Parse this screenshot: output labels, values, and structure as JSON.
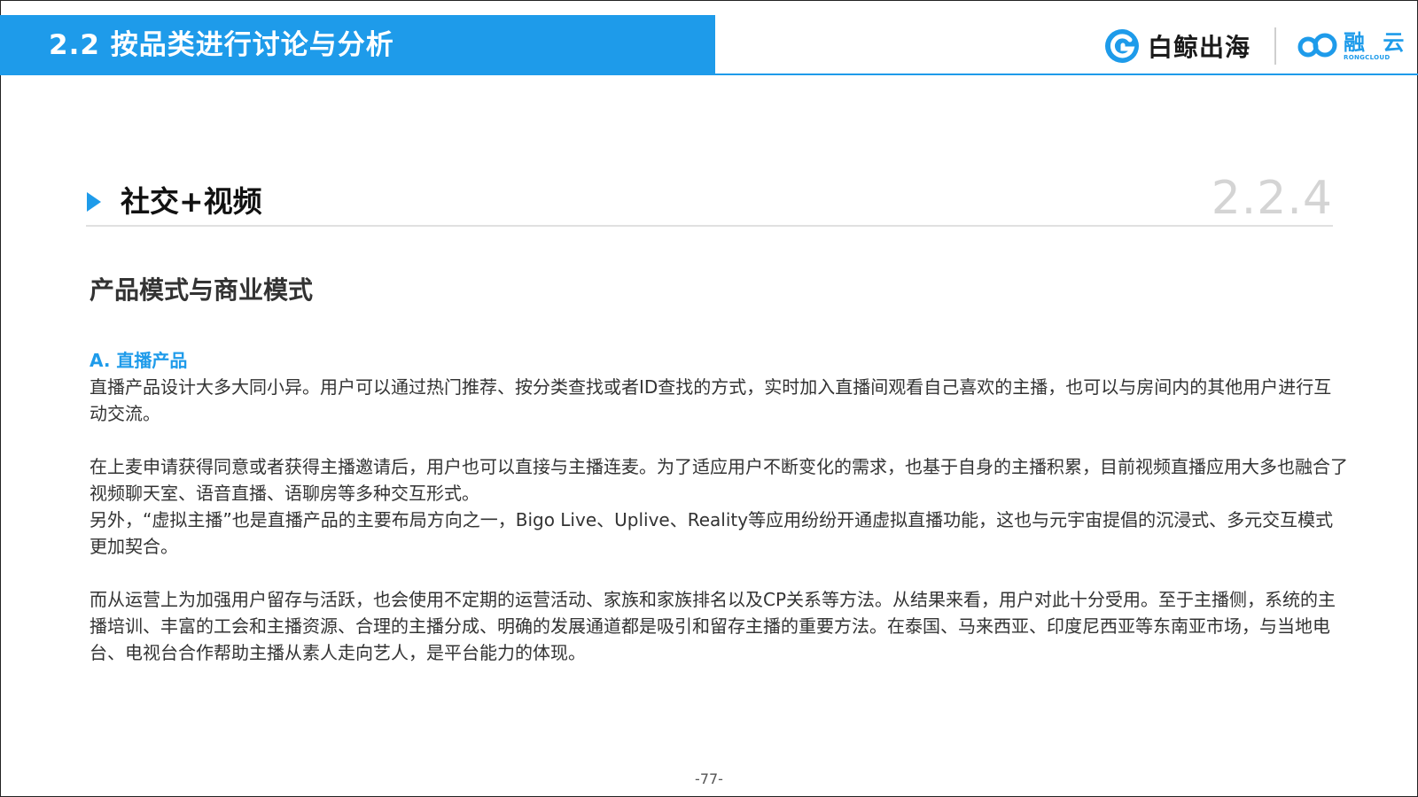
{
  "header": {
    "title": "2.2 按品类进行讨论与分析",
    "logo_baijing": "白鲸出海",
    "logo_rongcloud_cn": "融 云",
    "logo_rongcloud_en": "RONGCLOUD"
  },
  "section": {
    "title": "社交+视频",
    "number": "2.2.4"
  },
  "subheading": "产品模式与商业模式",
  "item_a_label": "A. 直播产品",
  "paragraphs": {
    "p1": "直播产品设计大多大同小异。用户可以通过热门推荐、按分类查找或者ID查找的方式，实时加入直播间观看自己喜欢的主播，也可以与房间内的其他用户进行互动交流。",
    "p2": "在上麦申请获得同意或者获得主播邀请后，用户也可以直接与主播连麦。为了适应用户不断变化的需求，也基于自身的主播积累，目前视频直播应用大多也融合了视频聊天室、语音直播、语聊房等多种交互形式。",
    "p3": "另外，“虚拟主播”也是直播产品的主要布局方向之一，Bigo Live、Uplive、Reality等应用纷纷开通虚拟直播功能，这也与元宇宙提倡的沉浸式、多元交互模式更加契合。",
    "p4": "而从运营上为加强用户留存与活跃，也会使用不定期的运营活动、家族和家族排名以及CP关系等方法。从结果来看，用户对此十分受用。至于主播侧，系统的主播培训、丰富的工会和主播资源、合理的主播分成、明确的发展通道都是吸引和留存主播的重要方法。在泰国、马来西亚、印度尼西亚等东南亚市场，与当地电台、电视台合作帮助主播从素人走向艺人，是平台能力的体现。"
  },
  "page_number": "-77-",
  "colors": {
    "accent": "#1e9bea",
    "text": "#333333",
    "section_number": "#d4d4d4"
  }
}
